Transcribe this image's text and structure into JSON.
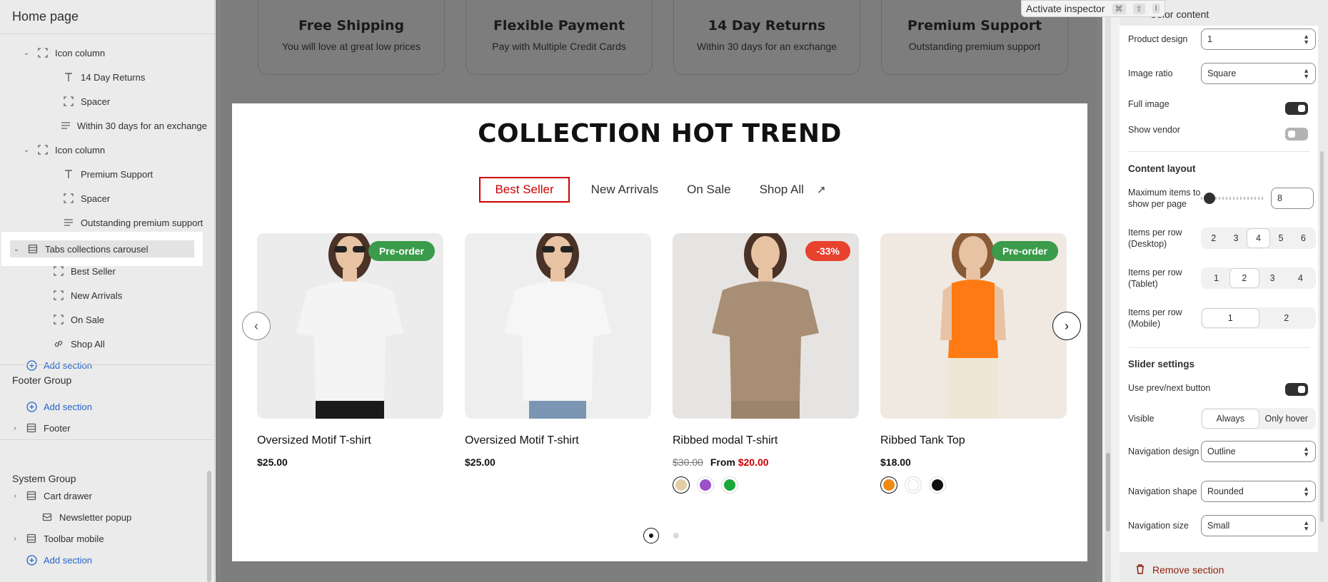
{
  "sidebar": {
    "title": "Home page",
    "tree": [
      {
        "label": "Icon column",
        "icon": "section-icon",
        "indent": 1,
        "chevron": "down"
      },
      {
        "label": "14 Day Returns",
        "icon": "text-icon",
        "indent": 2
      },
      {
        "label": "Spacer",
        "icon": "section-icon",
        "indent": 2
      },
      {
        "label": "Within 30 days for an exchange",
        "icon": "paragraph-icon",
        "indent": 2
      },
      {
        "label": "Icon column",
        "icon": "section-icon",
        "indent": 1,
        "chevron": "down"
      },
      {
        "label": "Premium Support",
        "icon": "text-icon",
        "indent": 2
      },
      {
        "label": "Spacer",
        "icon": "section-icon",
        "indent": 2
      },
      {
        "label": "Outstanding premium support",
        "icon": "paragraph-icon",
        "indent": 2
      },
      {
        "label": "Tabs collections carousel",
        "icon": "layout-icon",
        "indent": 0,
        "chevron": "down",
        "selected": true
      },
      {
        "label": "Best Seller",
        "icon": "section-icon",
        "indent": 1
      },
      {
        "label": "New Arrivals",
        "icon": "section-icon",
        "indent": 1
      },
      {
        "label": "On Sale",
        "icon": "section-icon",
        "indent": 1
      },
      {
        "label": "Shop All",
        "icon": "link-icon",
        "indent": 1
      }
    ],
    "add_section": "Add section",
    "footer_group": {
      "title": "Footer Group",
      "add_section": "Add section",
      "items": [
        "Footer"
      ]
    },
    "system_group": {
      "title": "System Group",
      "items": [
        "Cart drawer",
        "Newsletter popup",
        "Toolbar mobile"
      ],
      "add_section": "Add section"
    }
  },
  "features": [
    {
      "title": "Free Shipping",
      "text": "You will love at great low prices"
    },
    {
      "title": "Flexible Payment",
      "text": "Pay with Multiple Credit Cards"
    },
    {
      "title": "14 Day Returns",
      "text": "Within 30 days for an exchange"
    },
    {
      "title": "Premium Support",
      "text": "Outstanding premium support"
    }
  ],
  "collection": {
    "title": "COLLECTION HOT TREND",
    "tabs": [
      "Best Seller",
      "New Arrivals",
      "On Sale",
      "Shop All"
    ],
    "active_tab": "Best Seller",
    "products": [
      {
        "name": "Oversized Motif T-shirt",
        "price": "$25.00",
        "badge": "Pre-order",
        "badge_color": "#3a9b4a",
        "shirt_color": "#f4f4f4",
        "bg": "#ececec"
      },
      {
        "name": "Oversized Motif T-shirt",
        "price": "$25.00",
        "badge": "",
        "shirt_color": "#f6f6f6",
        "bg": "#eeeeee"
      },
      {
        "name": "Ribbed modal T-shirt",
        "old_price": "$30.00",
        "from_label": "From",
        "price": "$20.00",
        "badge": "-33%",
        "badge_color": "#e8412e",
        "shirt_color": "#a88e74",
        "bg": "#e6e4e2",
        "swatches": [
          "#e3cfa5",
          "#9b4fc9",
          "#1aa83a"
        ]
      },
      {
        "name": "Ribbed Tank Top",
        "price": "$18.00",
        "badge": "Pre-order",
        "badge_color": "#3a9b4a",
        "shirt_color": "#ff7a12",
        "bg": "#efe9e2",
        "swatches": [
          "#f08a12",
          "#ffffff",
          "#111111"
        ]
      }
    ],
    "pagination": {
      "pages": 2,
      "current": 1
    }
  },
  "inspector": {
    "label": "Activate inspector",
    "keys": [
      "⌘",
      "⇧",
      "I"
    ]
  },
  "right_panel": {
    "title": "Color content",
    "product_design": {
      "label": "Product design",
      "value": "1"
    },
    "image_ratio": {
      "label": "Image ratio",
      "value": "Square"
    },
    "full_image": {
      "label": "Full image",
      "on": true
    },
    "show_vendor": {
      "label": "Show vendor",
      "on": false
    },
    "content_layout": "Content layout",
    "max_items": {
      "label": "Maximum items to show per page",
      "value": "8"
    },
    "per_row_desktop": {
      "label": "Items per row (Desktop)",
      "options": [
        "2",
        "3",
        "4",
        "5",
        "6"
      ],
      "selected": "4"
    },
    "per_row_tablet": {
      "label": "Items per row (Tablet)",
      "options": [
        "1",
        "2",
        "3",
        "4"
      ],
      "selected": "2"
    },
    "per_row_mobile": {
      "label": "Items per row (Mobile)",
      "options": [
        "1",
        "2"
      ],
      "selected": "1"
    },
    "slider_settings": "Slider settings",
    "use_prev_next": {
      "label": "Use prev/next button",
      "on": true
    },
    "visible": {
      "label": "Visible",
      "options": [
        "Always",
        "Only hover"
      ],
      "selected": "Always"
    },
    "nav_design": {
      "label": "Navigation design",
      "value": "Outline"
    },
    "nav_shape": {
      "label": "Navigation shape",
      "value": "Rounded"
    },
    "nav_size": {
      "label": "Navigation size",
      "value": "Small"
    },
    "remove": "Remove section"
  }
}
